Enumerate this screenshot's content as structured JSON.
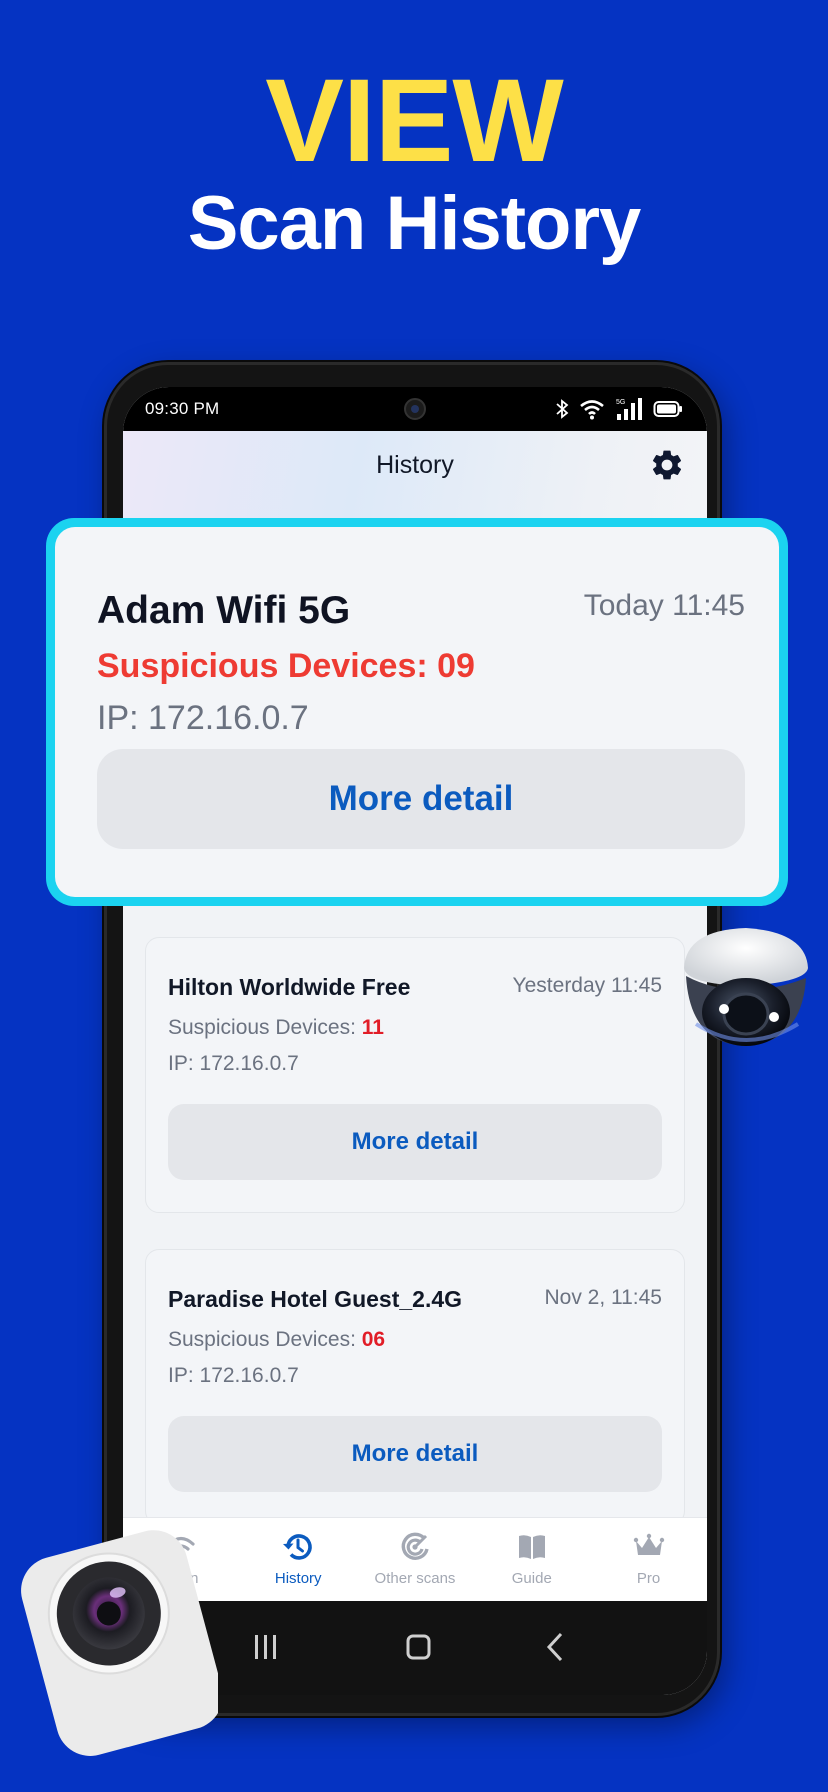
{
  "promo": {
    "headline": "VIEW",
    "subheadline": "Scan History"
  },
  "colors": {
    "background": "#0533c2",
    "headline": "#fde047",
    "accent": "#0b5bbf",
    "highlight_border": "#1bd3f0",
    "danger": "#e11d27"
  },
  "status_bar": {
    "time": "09:30 PM",
    "network": "5G",
    "icons": [
      "bluetooth-icon",
      "wifi-icon",
      "signal-icon",
      "battery-icon"
    ]
  },
  "app_bar": {
    "title": "History",
    "settings_icon": "gear-icon"
  },
  "featured_scan": {
    "network_name": "Adam Wifi 5G",
    "timestamp": "Today 11:45",
    "suspicious_label": "Suspicious Devices: ",
    "suspicious_count": "09",
    "ip": "IP: 172.16.0.7",
    "button_label": "More detail"
  },
  "scan_history": [
    {
      "network_name": "Hilton Worldwide Free",
      "timestamp": "Yesterday 11:45",
      "suspicious_label": "Suspicious Devices: ",
      "suspicious_count": "11",
      "ip": "IP: 172.16.0.7",
      "button_label": "More detail"
    },
    {
      "network_name": "Paradise Hotel Guest_2.4G",
      "timestamp": "Nov 2, 11:45",
      "suspicious_label": "Suspicious Devices: ",
      "suspicious_count": "06",
      "ip": "IP: 172.16.0.7",
      "button_label": "More detail"
    }
  ],
  "bottom_nav": {
    "items": [
      {
        "label": "Scan",
        "icon": "wifi-scan-icon",
        "active": false
      },
      {
        "label": "History",
        "icon": "history-icon",
        "active": true
      },
      {
        "label": "Other scans",
        "icon": "radar-icon",
        "active": false
      },
      {
        "label": "Guide",
        "icon": "book-icon",
        "active": false
      },
      {
        "label": "Pro",
        "icon": "crown-icon",
        "active": false
      }
    ]
  },
  "system_nav": {
    "buttons": [
      "recents-icon",
      "home-icon",
      "back-icon"
    ]
  }
}
